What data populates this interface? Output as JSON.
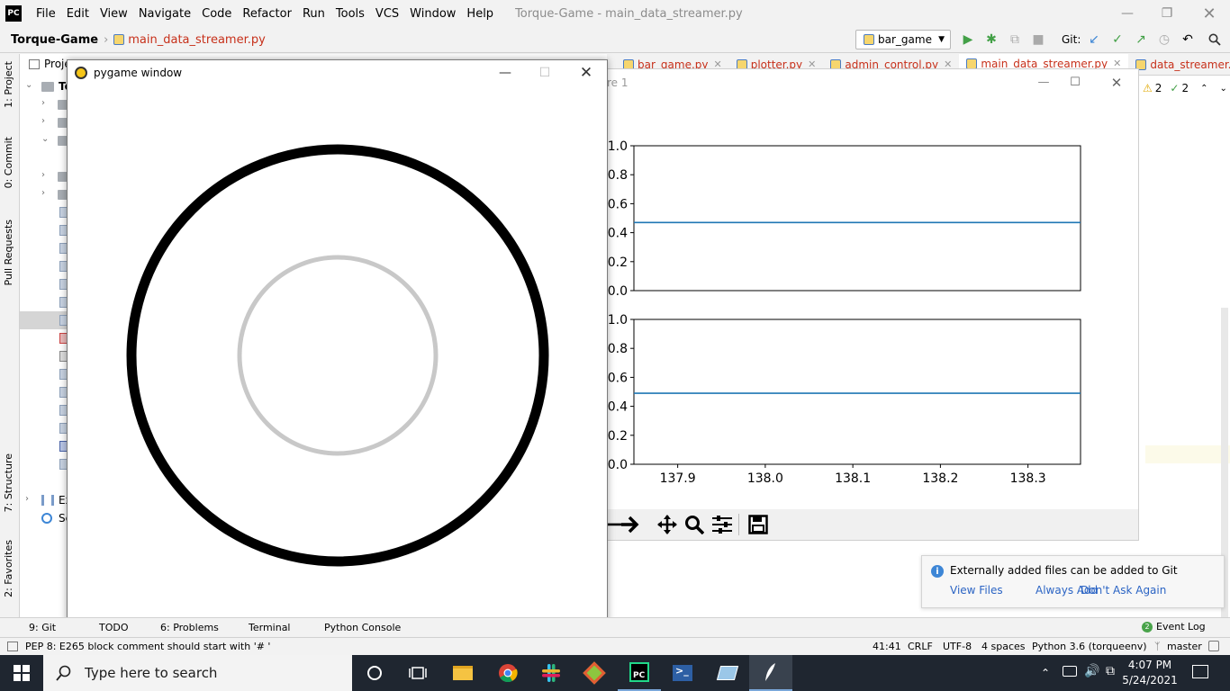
{
  "ide": {
    "logo": "PC",
    "menu": [
      "File",
      "Edit",
      "View",
      "Navigate",
      "Code",
      "Refactor",
      "Run",
      "Tools",
      "VCS",
      "Window",
      "Help"
    ],
    "window_title": "Torque-Game - main_data_streamer.py",
    "breadcrumb_project": "Torque-Game",
    "breadcrumb_file": "main_data_streamer.py",
    "run_config": "bar_game",
    "git_label": "Git:",
    "project_tab": "Proje",
    "editor_tabs": [
      "bar_game.py",
      "plotter.py",
      "admin_control.py",
      "main_data_streamer.py",
      "data_streamer.py"
    ],
    "inspection": {
      "warnings": "2",
      "weak": "2"
    },
    "left_tabs": [
      "1: Project",
      "0: Commit",
      "Pull Requests",
      "7: Structure",
      "2: Favorites"
    ],
    "tree_labels": {
      "top": "To",
      "ext": "Ex",
      "scratch": "Sc"
    }
  },
  "figure": {
    "title_fragment": "re 1",
    "chart_data": [
      {
        "type": "line",
        "x": [
          137.85,
          137.9,
          138.0,
          138.1,
          138.2,
          138.3,
          138.36
        ],
        "series": [
          {
            "values": [
              0.47,
              0.47,
              0.47,
              0.47,
              0.47,
              0.47,
              0.47
            ],
            "color": "#1f77b4"
          }
        ],
        "xlim": [
          137.85,
          138.36
        ],
        "ylim": [
          0.0,
          1.0
        ],
        "yticks": [
          "0.0",
          "0.2",
          "0.4",
          "0.6",
          "0.8",
          "1.0"
        ],
        "xticks": []
      },
      {
        "type": "line",
        "x": [
          137.85,
          137.9,
          138.0,
          138.1,
          138.2,
          138.3,
          138.36
        ],
        "series": [
          {
            "values": [
              0.49,
              0.49,
              0.49,
              0.49,
              0.49,
              0.49,
              0.49
            ],
            "color": "#1f77b4"
          }
        ],
        "xlim": [
          137.85,
          138.36
        ],
        "ylim": [
          0.0,
          1.0
        ],
        "yticks": [
          "0.0",
          "0.2",
          "0.4",
          "0.6",
          "0.8",
          "1.0"
        ],
        "xticks": [
          "137.9",
          "138.0",
          "138.1",
          "138.2",
          "138.3"
        ]
      }
    ],
    "toolbar_icons": [
      "back-arrow-icon",
      "forward-arrow-icon",
      "pan-icon",
      "zoom-icon",
      "configure-icon",
      "save-icon"
    ]
  },
  "pygame": {
    "title": "pygame window",
    "outer_ring_color": "#000000",
    "inner_ring_color": "#c8c8c8"
  },
  "notification": {
    "message": "Externally added files can be added to Git",
    "actions": [
      "View Files",
      "Always Add",
      "Don't Ask Again"
    ]
  },
  "tool_tabs": [
    "9: Git",
    "TODO",
    "6: Problems",
    "Terminal",
    "Python Console"
  ],
  "event_log": {
    "label": "Event Log",
    "count": "2"
  },
  "status": {
    "message": "PEP 8: E265 block comment should start with '# '",
    "position": "41:41",
    "line_sep": "CRLF",
    "encoding": "UTF-8",
    "indent": "4 spaces",
    "interpreter": "Python 3.6 (torqueenv)",
    "branch": "master"
  },
  "taskbar": {
    "search_placeholder": "Type here to search",
    "time": "4:07 PM",
    "date": "5/24/2021"
  }
}
